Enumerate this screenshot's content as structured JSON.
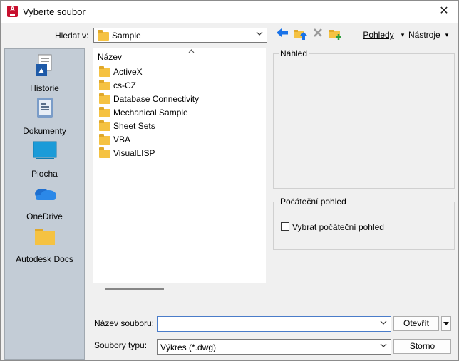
{
  "window": {
    "title": "Vyberte soubor",
    "close_glyph": "✕",
    "app_icon_letter": "A"
  },
  "lookin": {
    "label": "Hledat v:",
    "value": "Sample"
  },
  "toolbar": {
    "views_label": "Pohledy",
    "tools_label": "Nástroje",
    "dropdown_glyph": "▾"
  },
  "places": [
    {
      "label": "Historie",
      "icon": "history-icon"
    },
    {
      "label": "Dokumenty",
      "icon": "documents-icon"
    },
    {
      "label": "Plocha",
      "icon": "desktop-icon"
    },
    {
      "label": "OneDrive",
      "icon": "onedrive-icon"
    },
    {
      "label": "Autodesk Docs",
      "icon": "folder-icon"
    }
  ],
  "filelist": {
    "column_header": "Název",
    "items": [
      "ActiveX",
      "cs-CZ",
      "Database Connectivity",
      "Mechanical Sample",
      "Sheet Sets",
      "VBA",
      "VisualLISP"
    ]
  },
  "preview": {
    "title": "Náhled"
  },
  "initial_view": {
    "title": "Počáteční pohled",
    "checkbox_label": "Vybrat počáteční pohled",
    "checked": false
  },
  "filename": {
    "label": "Název souboru:",
    "value": "",
    "open_button": "Otevřít"
  },
  "filetype": {
    "label": "Soubory typu:",
    "value": "Výkres (*.dwg)",
    "cancel_button": "Storno"
  },
  "colors": {
    "accent": "#1a73e8",
    "sidebar": "#c3ccd6",
    "brand": "#c8102e"
  }
}
